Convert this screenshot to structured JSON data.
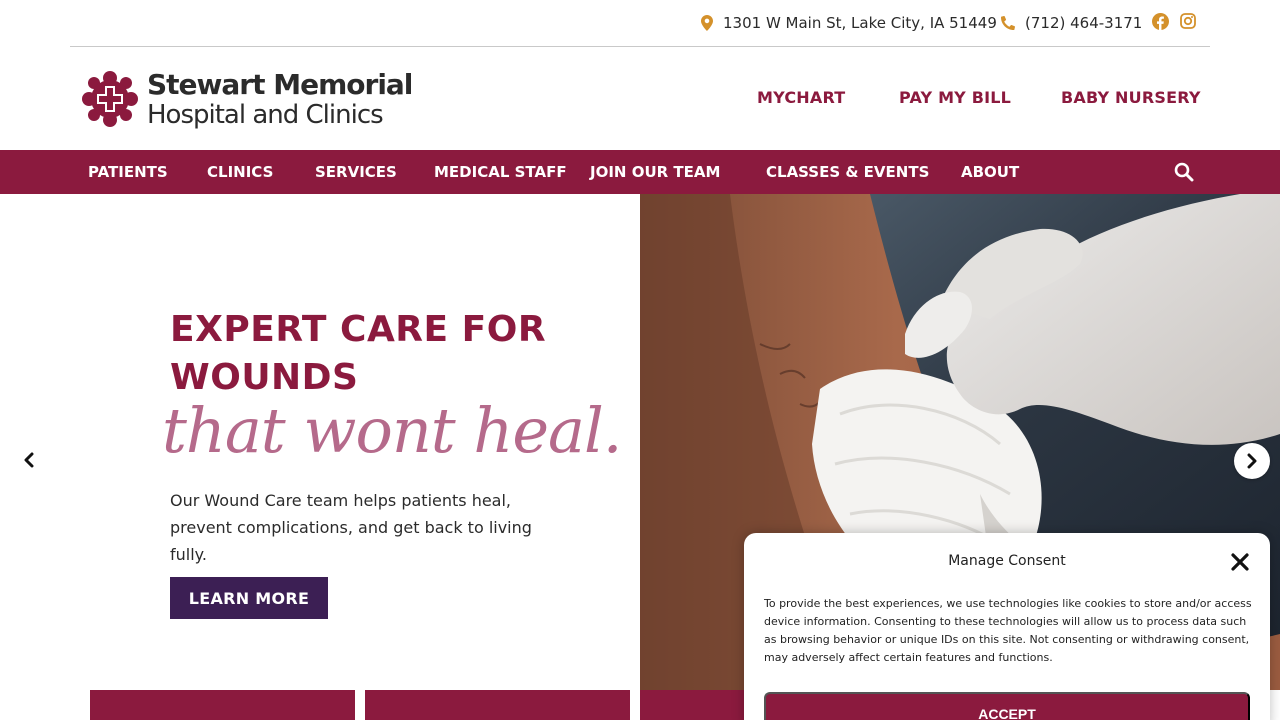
{
  "topbar": {
    "address": "1301 W Main St, Lake City, IA 51449",
    "phone": "(712) 464-3171",
    "social": [
      {
        "icon": "facebook-icon"
      },
      {
        "icon": "instagram-icon"
      }
    ]
  },
  "brand": {
    "line1": "Stewart Memorial",
    "line2": "Hospital and Clinics"
  },
  "quicklinks": [
    "MYCHART",
    "PAY MY BILL",
    "BABY NURSERY"
  ],
  "nav": {
    "items": [
      "PATIENTS",
      "CLINICS",
      "SERVICES",
      "MEDICAL STAFF",
      "JOIN OUR TEAM",
      "CLASSES & EVENTS",
      "ABOUT"
    ],
    "search_icon": "search-icon"
  },
  "hero": {
    "headline": "EXPERT CARE FOR WOUNDS",
    "script": "that wont heal.",
    "body": "Our Wound Care team helps patients heal, prevent complications, and get back to living fully.",
    "button": "LEARN MORE"
  },
  "consent": {
    "title": "Manage Consent",
    "text": "To provide the best experiences, we use technologies like cookies to store and/or access device information. Consenting to these technologies will allow us to process data such as browsing behavior or unique IDs on this site. Not consenting or withdrawing consent, may adversely affect certain features and functions.",
    "accept": "ACCEPT"
  },
  "colors": {
    "brand": "#8b1a3e",
    "accent_gold": "#d4912b",
    "button_dark": "#3c1f54",
    "script_pink": "#b56a8b"
  }
}
